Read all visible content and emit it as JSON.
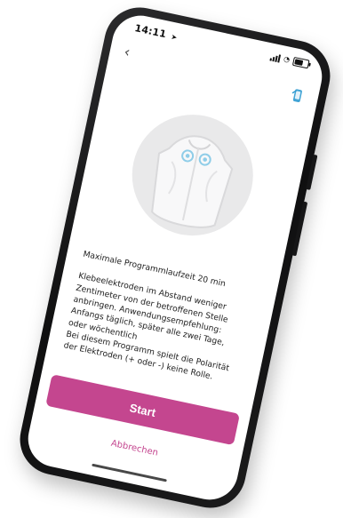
{
  "status_bar": {
    "time": "14:11",
    "location_icon": "location-arrow-icon"
  },
  "nav": {
    "back_icon": "chevron-left-icon",
    "device_icon": "smartphone-icon"
  },
  "illustration": {
    "type": "jacket-with-electrodes-illustration",
    "colors": {
      "circle": "#e9e9ea",
      "electrode_ring": "#8fcde8",
      "shirt": "#f8f8f9"
    }
  },
  "content": {
    "max_runtime": "Maximale Programmlaufzeit 20 min",
    "instructions": "Klebeelektroden im Abstand weniger\nZentimeter von der betroffenen Stelle\nanbringen. Anwendungsempfehlung:\nAnfangs täglich, später alle zwei Tage,\noder wöchentlich\nBei diesem Programm spielt die Polarität\nder Elektroden (+ oder -) keine Rolle."
  },
  "actions": {
    "start_label": "Start",
    "cancel_label": "Abbrechen"
  },
  "colors": {
    "accent": "#c4468f",
    "background": "#ffffff"
  }
}
